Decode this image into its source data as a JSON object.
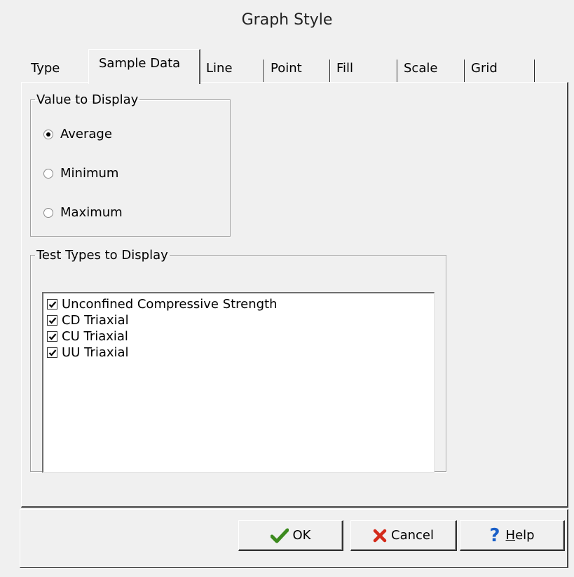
{
  "window": {
    "title": "Graph Style"
  },
  "tabs": [
    {
      "label": "Type",
      "active": false
    },
    {
      "label": "Sample Data",
      "active": true
    },
    {
      "label": "Line",
      "active": false
    },
    {
      "label": "Point",
      "active": false
    },
    {
      "label": "Fill",
      "active": false
    },
    {
      "label": "Scale",
      "active": false
    },
    {
      "label": "Grid",
      "active": false
    }
  ],
  "value_group": {
    "legend": "Value to Display",
    "options": [
      {
        "label": "Average",
        "selected": true
      },
      {
        "label": "Minimum",
        "selected": false
      },
      {
        "label": "Maximum",
        "selected": false
      }
    ]
  },
  "test_types_group": {
    "legend": "Test Types to Display",
    "items": [
      {
        "label": "Unconfined Compressive Strength",
        "checked": true
      },
      {
        "label": "CD Triaxial",
        "checked": true
      },
      {
        "label": "CU Triaxial",
        "checked": true
      },
      {
        "label": "UU Triaxial",
        "checked": true
      }
    ]
  },
  "buttons": {
    "ok": "OK",
    "cancel": "Cancel",
    "help_mnemonic": "H",
    "help_rest": "elp"
  },
  "colors": {
    "background": "#f0f0f0",
    "ok_check": "#3c8a1e",
    "cancel_x": "#d42a1a",
    "help_q": "#1a5fc8"
  }
}
